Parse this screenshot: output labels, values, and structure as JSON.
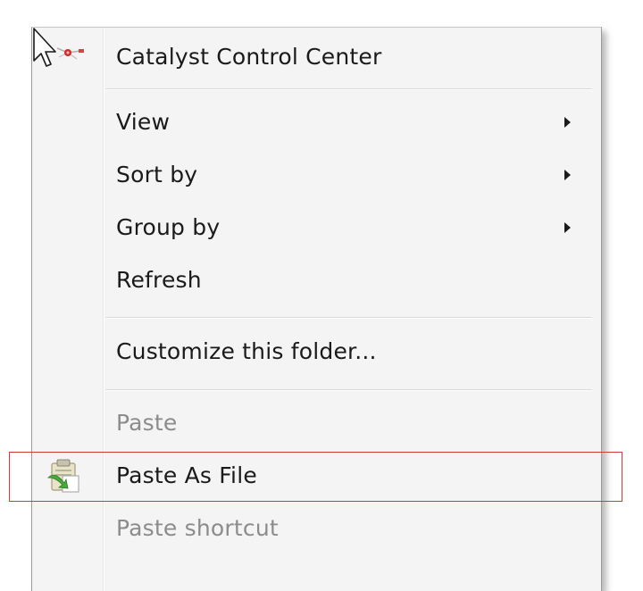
{
  "context_menu": {
    "items": [
      {
        "label": "Catalyst Control Center",
        "icon": "catalyst-control-center-icon",
        "submenu": false,
        "disabled": false
      },
      {
        "label": "View",
        "submenu": true,
        "disabled": false
      },
      {
        "label": "Sort by",
        "submenu": true,
        "disabled": false
      },
      {
        "label": "Group by",
        "submenu": true,
        "disabled": false
      },
      {
        "label": "Refresh",
        "submenu": false,
        "disabled": false
      },
      {
        "label": "Customize this folder...",
        "submenu": false,
        "disabled": false
      },
      {
        "label": "Paste",
        "submenu": false,
        "disabled": true
      },
      {
        "label": "Paste As File",
        "icon": "paste-as-file-icon",
        "submenu": false,
        "disabled": false,
        "highlighted": true
      },
      {
        "label": "Paste shortcut",
        "submenu": false,
        "disabled": true
      }
    ]
  },
  "colors": {
    "menu_background": "#f4f4f4",
    "highlight_border": "#d23a3a",
    "disabled_text": "#8c8c8c",
    "text": "#1a1a1a"
  }
}
